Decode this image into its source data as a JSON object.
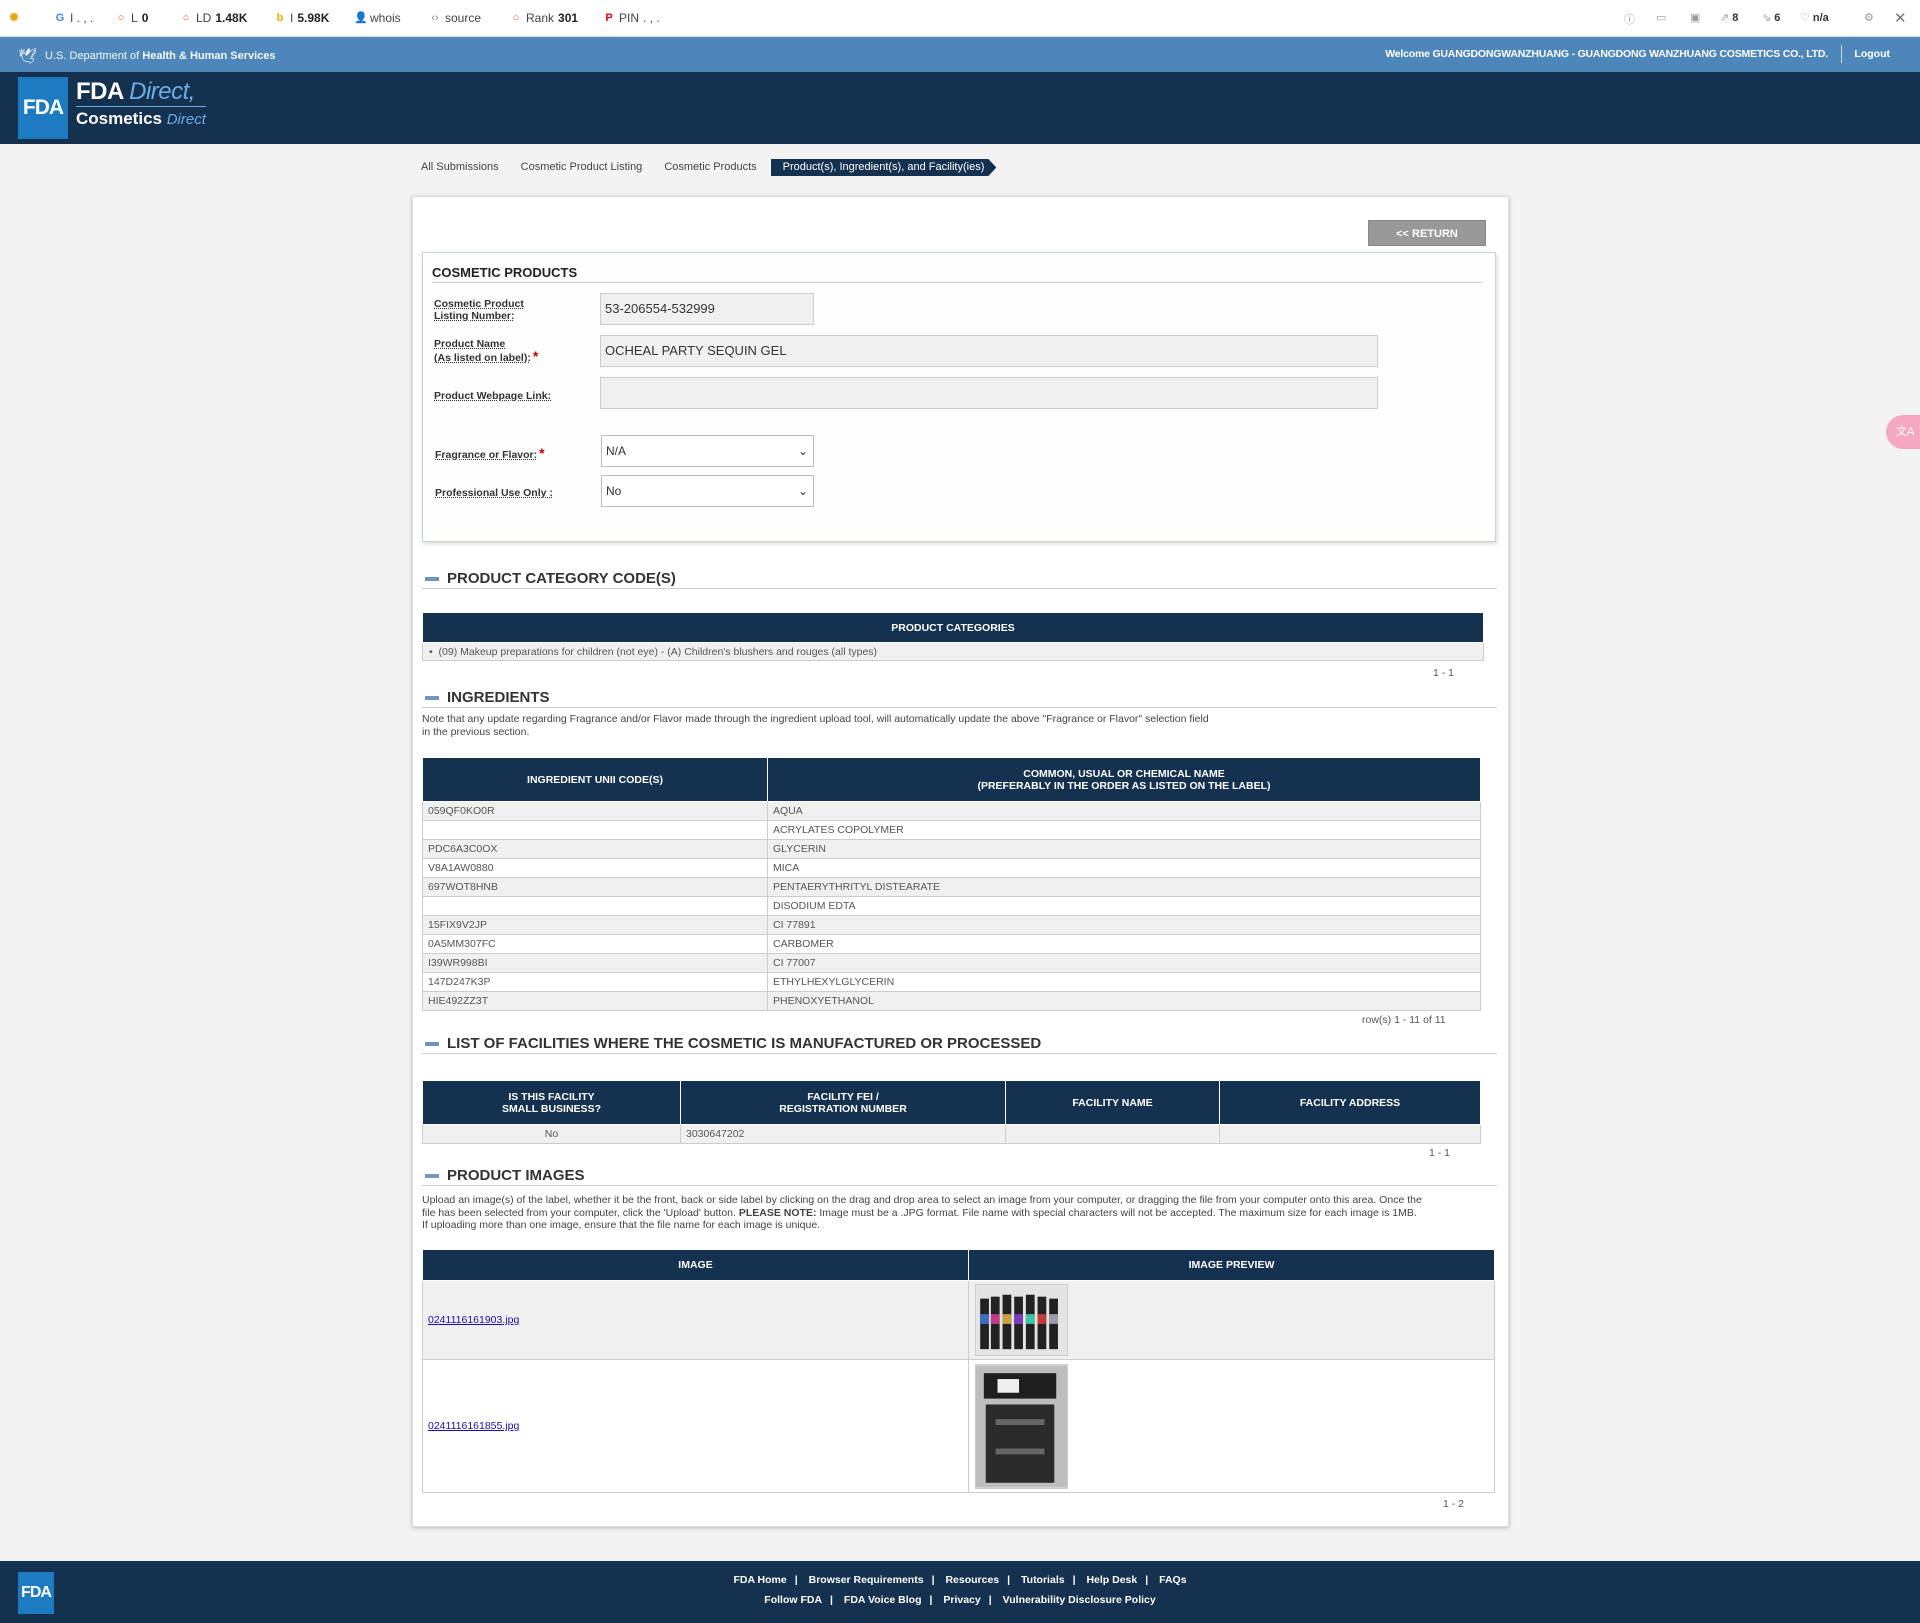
{
  "ext_bar": {
    "items": [
      {
        "icon": "google-icon",
        "label": "I . , .",
        "value": ""
      },
      {
        "icon": "circle-icon",
        "label": "L",
        "value": "0"
      },
      {
        "icon": "circle-icon",
        "label": "LD",
        "value": "1.48K"
      },
      {
        "icon": "bing-icon",
        "label": "I",
        "value": "5.98K"
      },
      {
        "icon": "person-icon",
        "label": "whois",
        "value": ""
      },
      {
        "icon": "code-icon",
        "label": "source",
        "value": ""
      },
      {
        "icon": "circle-icon",
        "label": "Rank",
        "value": "301"
      },
      {
        "icon": "pinterest-icon",
        "label": "PIN",
        "value": ". , ."
      }
    ],
    "right": {
      "ext_links": "8",
      "int_links": "6",
      "status": "n/a"
    }
  },
  "hhs": {
    "dept_prefix": "U.S. Department of ",
    "dept_name": "Health & Human Services",
    "welcome": "Welcome GUANGDONGWANZHUANG - GUANGDONG WANZHUANG COSMETICS CO., LTD.",
    "logout": "Logout"
  },
  "brand": {
    "logo": "FDA",
    "line1_bold": "FDA",
    "line1_italic": "Direct,",
    "line2_bold": "Cosmetics",
    "line2_italic": "Direct"
  },
  "breadcrumb": [
    "All Submissions",
    "Cosmetic Product Listing",
    "Cosmetic Products",
    "Product(s), Ingredient(s), and Facility(ies)"
  ],
  "return_label": "<< RETURN",
  "cosmetic_products": {
    "title": "COSMETIC PRODUCTS",
    "listing_number_label_1": "Cosmetic Product",
    "listing_number_label_2": "Listing Number:",
    "listing_number": "53-206554-532999",
    "product_name_label_1": "Product Name",
    "product_name_label_2": "(As listed on label):",
    "product_name": "OCHEAL PARTY SEQUIN GEL",
    "webpage_label": "Product Webpage Link:",
    "webpage_value": "",
    "fragrance_label": "Fragrance or Flavor:",
    "fragrance_value": "N/A",
    "professional_label": "Professional Use Only :",
    "professional_value": "No",
    "required_mark": "*"
  },
  "category": {
    "title": "PRODUCT CATEGORY CODE(S)",
    "header": "PRODUCT CATEGORIES",
    "items": [
      "(09) Makeup preparations for children (not eye) - (A) Children's blushers and rouges (all types)"
    ],
    "pager": "1 - 1"
  },
  "ingredients": {
    "title": "INGREDIENTS",
    "note_1": "Note that any update regarding Fragrance and/or Flavor made through the ingredient upload tool, will automatically update the above \"Fragrance or Flavor\" selection field",
    "note_2": "in the previous section.",
    "col1": "INGREDIENT UNII CODE(S)",
    "col2_line1": "COMMON, USUAL OR CHEMICAL NAME",
    "col2_line2": "(PREFERABLY IN THE ORDER AS LISTED ON THE LABEL)",
    "rows": [
      [
        "059QF0KO0R",
        "AQUA"
      ],
      [
        "",
        "ACRYLATES COPOLYMER"
      ],
      [
        "PDC6A3C0OX",
        "GLYCERIN"
      ],
      [
        "V8A1AW0880",
        "MICA"
      ],
      [
        "697WOT8HNB",
        "PENTAERYTHRITYL DISTEARATE"
      ],
      [
        "",
        "DISODIUM EDTA"
      ],
      [
        "15FIX9V2JP",
        "CI 77891"
      ],
      [
        "0A5MM307FC",
        "CARBOMER"
      ],
      [
        "I39WR998BI",
        "CI 77007"
      ],
      [
        "147D247K3P",
        "ETHYLHEXYLGLYCERIN"
      ],
      [
        "HIE492ZZ3T",
        "PHENOXYETHANOL"
      ]
    ],
    "pager": "row(s) 1 - 11 of 11"
  },
  "facilities": {
    "title": "LIST OF FACILITIES WHERE THE COSMETIC IS MANUFACTURED OR PROCESSED",
    "col1_line1": "IS THIS FACILITY",
    "col1_line2": "SMALL BUSINESS?",
    "col2_line1": "FACILITY FEI /",
    "col2_line2": "REGISTRATION NUMBER",
    "col3": "FACILITY NAME",
    "col4": "FACILITY ADDRESS",
    "rows": [
      [
        "No",
        "3030647202",
        "",
        ""
      ]
    ],
    "pager": "1 - 1"
  },
  "images": {
    "title": "PRODUCT IMAGES",
    "note_1": "Upload an image(s) of the label, whether it be the front, back or side label by clicking on the drag and drop area to select an image from your computer, or dragging the file from your computer onto this area. Once the",
    "note_2a": "file has been selected from your computer, click the 'Upload' button. ",
    "note_2b": "PLEASE NOTE:",
    "note_2c": " Image must be a .JPG format. File name with special characters will not be accepted. The maximum size for each image is 1MB.",
    "note_3": "If uploading more than one image, ensure that the file name for each image is unique.",
    "col1": "IMAGE",
    "col2": "IMAGE PREVIEW",
    "rows": [
      {
        "file": "0241116161903.jpg"
      },
      {
        "file": "0241116161855.jpg"
      }
    ],
    "pager": "1 - 2"
  },
  "footer": {
    "logo": "FDA",
    "row1": [
      "FDA Home",
      "Browser Requirements",
      "Resources",
      "Tutorials",
      "Help Desk",
      "FAQs"
    ],
    "row2": [
      "Follow FDA",
      "FDA Voice Blog",
      "Privacy",
      "Vulnerability Disclosure Policy"
    ]
  },
  "colors": {
    "navy": "#14324f",
    "hhs_blue": "#4d86ba",
    "fda_blue": "#1c7bc1",
    "return_grey": "#999999"
  }
}
